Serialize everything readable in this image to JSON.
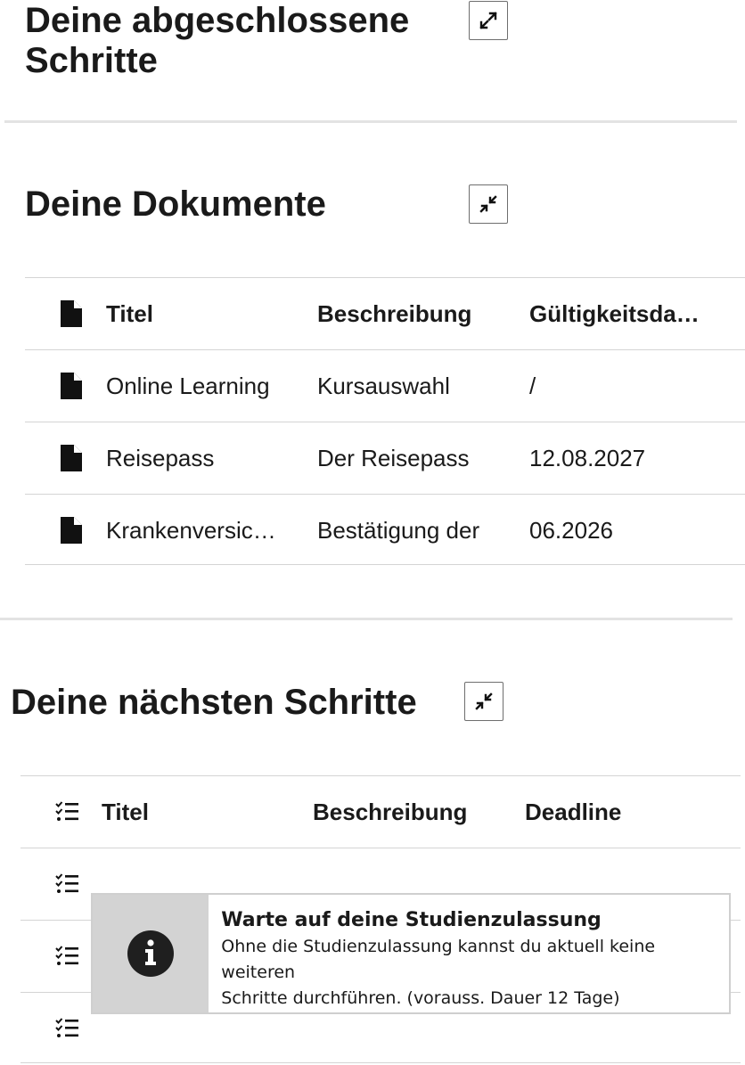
{
  "completed_section": {
    "title_line1": "Deine abgeschlossene",
    "title_line2": "Schritte",
    "toggle_icon": "expand-icon"
  },
  "documents_section": {
    "title": "Deine Dokumente",
    "toggle_icon": "collapse-icon",
    "columns": [
      "Titel",
      "Beschreibung",
      "Gültigkeitsdatum"
    ],
    "rows": [
      {
        "title": "Online Learning",
        "description": "Kursauswahl",
        "validity": "/"
      },
      {
        "title": "Reisepass",
        "description": "Der Reisepass",
        "validity": "12.08.2027"
      },
      {
        "title": "Krankenversicherung",
        "description": "Bestätigung der",
        "validity": "06.2026"
      }
    ]
  },
  "next_steps_section": {
    "title": "Deine nächsten Schritte",
    "toggle_icon": "collapse-icon",
    "columns": [
      "Titel",
      "Beschreibung",
      "Deadline"
    ],
    "rows": 3
  },
  "info_box": {
    "icon": "info-icon",
    "title": "Warte auf deine Studienzulassung",
    "text_line1": "Ohne die Studienzulassung kannst du aktuell keine weiteren",
    "text_line2": "Schritte durchführen. (vorauss. Dauer 12 Tage)"
  }
}
